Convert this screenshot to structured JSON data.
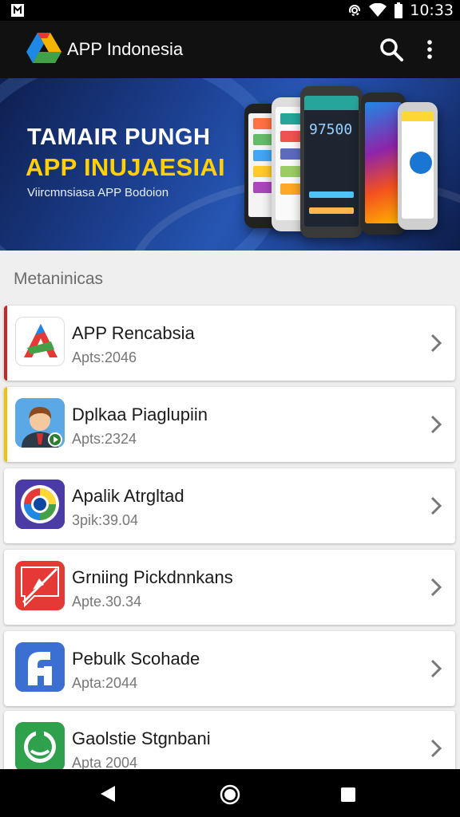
{
  "status_bar": {
    "time": "10:33",
    "icons": [
      "notification-icon",
      "hotspot-icon",
      "wifi-icon",
      "battery-icon"
    ]
  },
  "app_bar": {
    "title": "APP Indonesia",
    "logo": "app-logo-icon",
    "actions": [
      "search-icon",
      "more-vert-icon"
    ]
  },
  "banner": {
    "headline": "TAMAIR PUNGH",
    "headline_highlight": "APP INUJAESIAI",
    "subtitle": "Viircmnsiasa APP Bodoion",
    "phone_screen_text": "97500"
  },
  "section": {
    "title": "Metaninicas"
  },
  "apps": [
    {
      "name": "APP Rencabsia",
      "meta": "Apts:2046",
      "icon": "app-rencabsia-icon",
      "accent": "#c62828"
    },
    {
      "name": "Dplkaa Piaglupiin",
      "meta": "Apts:2324",
      "icon": "avatar-person-icon",
      "accent": "#f2c200"
    },
    {
      "name": "Apalik Atrgltad",
      "meta": "3pik:39.04",
      "icon": "camera-lens-icon",
      "accent": ""
    },
    {
      "name": "Grniing Pickdnnkans",
      "meta": "Apte.30.34",
      "icon": "red-chat-icon",
      "accent": ""
    },
    {
      "name": "Pebulk Scohade",
      "meta": "Apta:2044",
      "icon": "blue-f-icon",
      "accent": ""
    },
    {
      "name": "Gaolstie Stgnbani",
      "meta": "Apta 2004",
      "icon": "green-chat-icon",
      "accent": ""
    }
  ],
  "nav_bar": {
    "buttons": [
      "back-icon",
      "home-icon",
      "recents-icon"
    ]
  },
  "colors": {
    "status_bar": "#000000",
    "app_bar": "#111111",
    "banner_blue": "#2656b3",
    "highlight_yellow": "#ffd100",
    "background": "#efefef"
  }
}
